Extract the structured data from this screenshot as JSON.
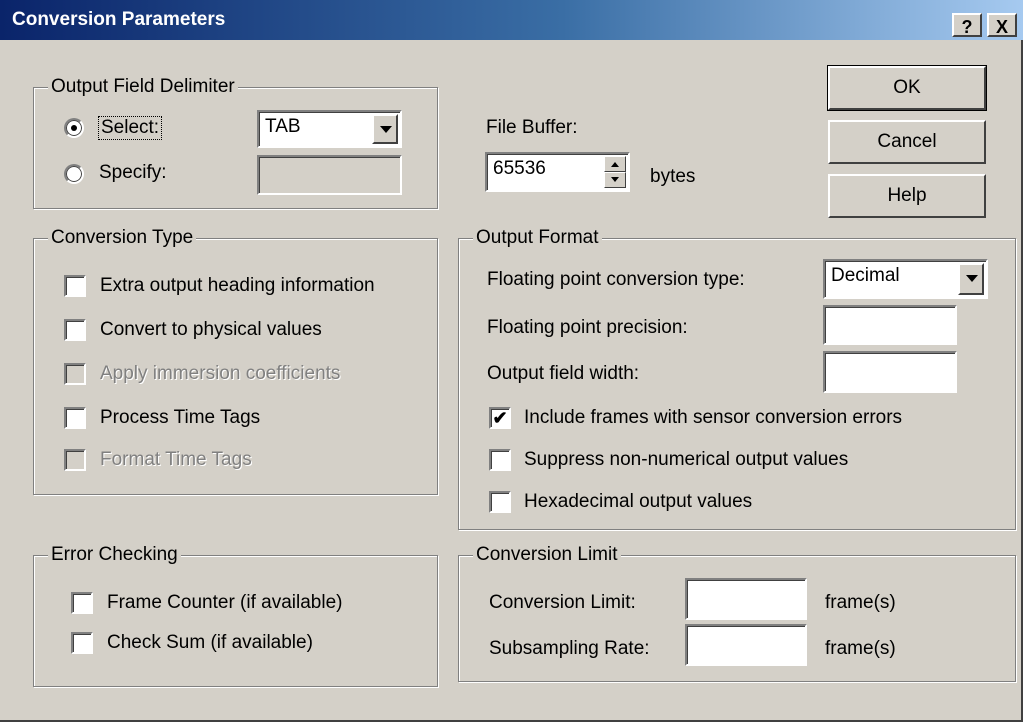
{
  "window": {
    "title": "Conversion Parameters",
    "help_btn": "?",
    "close_btn": "X"
  },
  "delimiter": {
    "legend": "Output Field Delimiter",
    "select_label": "Select:",
    "specify_label": "Specify:",
    "selected_option": "select",
    "select_value": "TAB",
    "specify_value": ""
  },
  "buffer": {
    "label": "File Buffer:",
    "value": "65536",
    "unit": "bytes"
  },
  "buttons": {
    "ok": "OK",
    "cancel": "Cancel",
    "help": "Help"
  },
  "conversion_type": {
    "legend": "Conversion Type",
    "items": [
      {
        "label": "Extra output heading information",
        "checked": false,
        "enabled": true
      },
      {
        "label": "Convert to physical values",
        "checked": false,
        "enabled": true
      },
      {
        "label": "Apply immersion coefficients",
        "checked": false,
        "enabled": false
      },
      {
        "label": "Process Time Tags",
        "checked": false,
        "enabled": true
      },
      {
        "label": "Format Time Tags",
        "checked": false,
        "enabled": false
      }
    ]
  },
  "output_format": {
    "legend": "Output Format",
    "fp_type_label": "Floating point conversion type:",
    "fp_type_value": "Decimal",
    "fp_precision_label": "Floating point precision:",
    "fp_precision_value": "",
    "field_width_label": "Output field width:",
    "field_width_value": "",
    "options": [
      {
        "label": "Include frames with sensor conversion errors",
        "checked": true
      },
      {
        "label": "Suppress non-numerical output values",
        "checked": false
      },
      {
        "label": "Hexadecimal output values",
        "checked": false
      }
    ]
  },
  "error_checking": {
    "legend": "Error Checking",
    "items": [
      {
        "label": "Frame Counter (if available)",
        "checked": false
      },
      {
        "label": "Check Sum (if available)",
        "checked": false
      }
    ]
  },
  "conversion_limit": {
    "legend": "Conversion Limit",
    "limit_label": "Conversion Limit:",
    "limit_value": "",
    "limit_unit": "frame(s)",
    "rate_label": "Subsampling Rate:",
    "rate_value": "",
    "rate_unit": "frame(s)"
  }
}
